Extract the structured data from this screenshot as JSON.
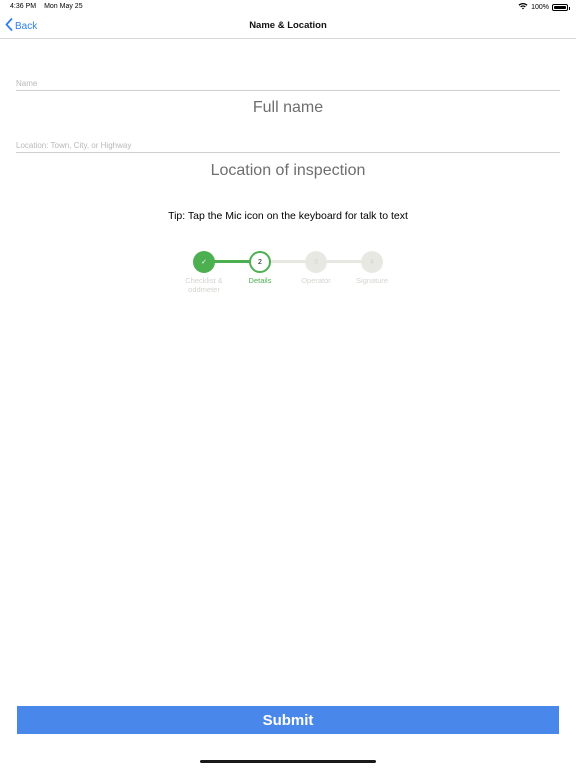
{
  "status_bar": {
    "time": "4:36 PM",
    "date": "Mon May 25",
    "battery": "100%"
  },
  "nav": {
    "back_label": "Back",
    "title": "Name & Location"
  },
  "form": {
    "name": {
      "placeholder": "Name",
      "value": "Full name"
    },
    "location": {
      "placeholder": "Location: Town, City, or Highway",
      "value": "Location of inspection"
    }
  },
  "tip": "Tip: Tap the Mic icon on the keyboard for talk to text",
  "stepper": {
    "steps": [
      {
        "number": "✓",
        "label": "Checklist & oddmeter",
        "state": "complete"
      },
      {
        "number": "2",
        "label": "Details",
        "state": "current"
      },
      {
        "number": "3",
        "label": "Operator",
        "state": "pending"
      },
      {
        "number": "4",
        "label": "Signature",
        "state": "pending"
      }
    ]
  },
  "submit_label": "Submit",
  "colors": {
    "accent": "#4a87ea",
    "back_link": "#2f80ed",
    "step_complete": "#4caf50",
    "step_pending": "#e8e8e2",
    "step_text_pending": "#d4d4cf"
  }
}
